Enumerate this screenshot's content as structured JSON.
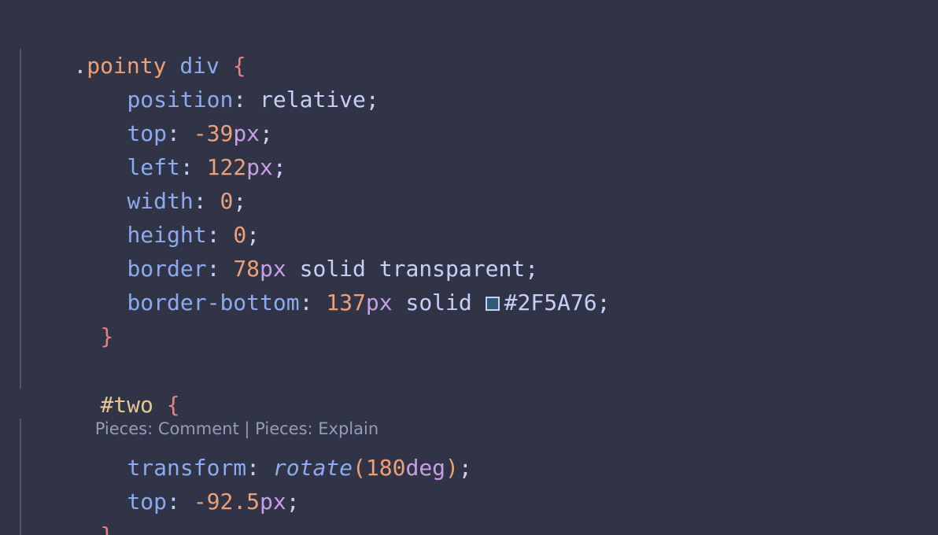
{
  "code": {
    "block1": {
      "selector_dot": ".",
      "selector_class": "pointy",
      "selector_tag": "div",
      "open_brace": "{",
      "close_brace": "}",
      "decls": [
        {
          "prop": "position",
          "value": "relative"
        },
        {
          "prop": "top",
          "num": "-39",
          "unit": "px"
        },
        {
          "prop": "left",
          "num": "122",
          "unit": "px"
        },
        {
          "prop": "width",
          "num": "0"
        },
        {
          "prop": "height",
          "num": "0"
        },
        {
          "prop": "border",
          "num": "78",
          "unit": "px",
          "rest": "solid transparent"
        },
        {
          "prop": "border-bottom",
          "num": "137",
          "unit": "px",
          "rest": "solid",
          "color": "#2F5A76"
        }
      ]
    },
    "block2": {
      "selector": "#two",
      "open_brace": "{",
      "close_brace": "}",
      "codelens": {
        "comment": "Pieces: Comment",
        "separator": " | ",
        "explain": "Pieces: Explain"
      },
      "decls": [
        {
          "prop": "transform",
          "fn": "rotate",
          "num": "180",
          "unit": "deg"
        },
        {
          "prop": "top",
          "num": "-92.5",
          "unit": "px"
        }
      ]
    }
  },
  "colors": {
    "background": "#303446",
    "swatch": "#2F5A76"
  }
}
